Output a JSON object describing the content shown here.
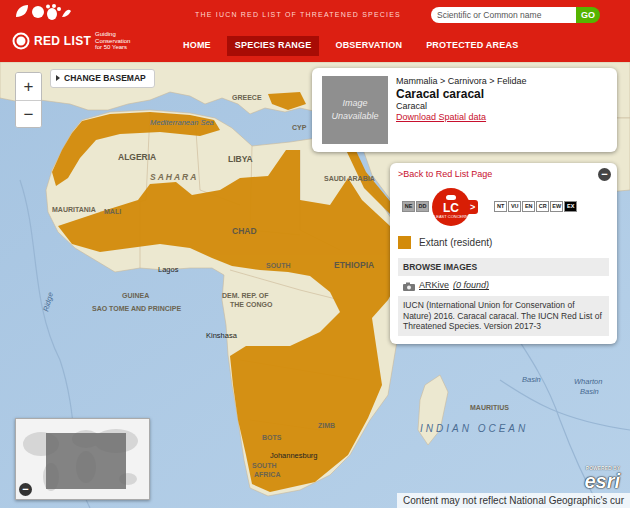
{
  "header": {
    "logo": {
      "title": "RED LIST",
      "subtitle": "Guiding Conservation for 50 Years"
    },
    "tagline": "THE IUCN RED LIST OF THREATENED SPECIES",
    "search": {
      "placeholder": "Scientific or Common name",
      "button": "GO"
    }
  },
  "nav": [
    {
      "label": "HOME",
      "selected": false
    },
    {
      "label": "SPECIES RANGE",
      "selected": true
    },
    {
      "label": "OBSERVATION",
      "selected": false
    },
    {
      "label": "PROTECTED AREAS",
      "selected": false
    }
  ],
  "map": {
    "zoom_in": "+",
    "zoom_out": "−",
    "basemap_button": "CHANGE BASEMAP",
    "labels": [
      "GREECE",
      "Mediterranean Sea",
      "CYP",
      "ALGERIA",
      "LIBYA",
      "SAHARA",
      "SAUDI ARABIA",
      "MAURITANIA",
      "MALI",
      "CHAD",
      "SOUTH",
      "ETHIOPIA",
      "Lagos",
      "GUINEA",
      "SAO TOME AND PRINCIPE",
      "DEM. REP. OF",
      "THE CONGO",
      "Kinshasa",
      "Ridge",
      "BOTS",
      "ZIMB",
      "Johannesburg",
      "SOUTH",
      "AFRICA",
      "INDIAN OCEAN",
      "MAURITIUS",
      "Basin",
      "Wharton",
      "Basin"
    ],
    "overview_toggle": "−",
    "powered_by": "POWERED BY",
    "esri": "esri",
    "attribution": "Content may not reflect National Geographic's cur"
  },
  "species_panel": {
    "image": "Image Unavailable",
    "taxonomy": "Mammalia > Carnivora > Felidae",
    "scientific_name": "Caracal caracal",
    "common_name": "Caracal",
    "download": "Download Spatial data"
  },
  "status_panel": {
    "close": "−",
    "back_link": ">Back to Red List Page",
    "categories": [
      {
        "code": "NE",
        "selected": false,
        "color": "#a8a8a8"
      },
      {
        "code": "DD",
        "selected": false,
        "color": "#a8a8a8"
      },
      {
        "code": "LC",
        "selected": true,
        "color": "#d81e05"
      },
      {
        "code": "NT",
        "selected": false,
        "color": "#ffffff"
      },
      {
        "code": "VU",
        "selected": false,
        "color": "#ffffff"
      },
      {
        "code": "EN",
        "selected": false,
        "color": "#ffffff"
      },
      {
        "code": "CR",
        "selected": false,
        "color": "#ffffff"
      },
      {
        "code": "EW",
        "selected": false,
        "color": "#ffffff"
      },
      {
        "code": "EX",
        "selected": false,
        "color": "#000000"
      }
    ],
    "selected_subtitle": "LEAST CONCERN",
    "pointer": ">",
    "legend": [
      {
        "label": "Extant (resident)",
        "color": "#d38b0a"
      }
    ],
    "browse_images": "BROWSE IMAGES",
    "arkive": {
      "label": "ARKive",
      "count": "(0 found)"
    },
    "citation": "IUCN (International Union for Conservation of Nature) 2016. Caracal caracal. The IUCN Red List of Threatened Species. Version 2017-3"
  }
}
